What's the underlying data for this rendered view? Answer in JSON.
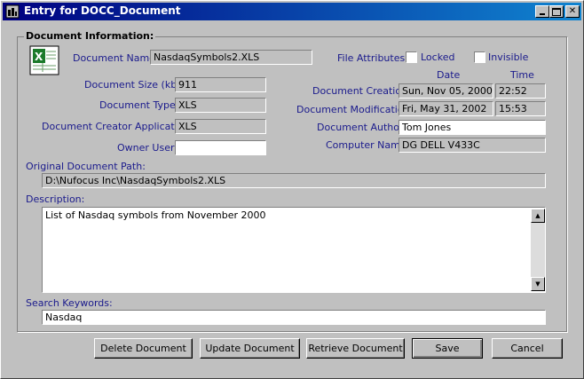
{
  "window": {
    "title": "Entry for DOCC_Document",
    "icon": "app-window-icon"
  },
  "group": {
    "title": "Document Information:"
  },
  "file_icon": "excel-file-icon",
  "fields": {
    "doc_name": {
      "label": "Document Name:",
      "value": "NasdaqSymbols2.XLS"
    },
    "doc_size": {
      "label": "Document Size (kb):",
      "value": "911"
    },
    "doc_type": {
      "label": "Document Type:",
      "value": "XLS"
    },
    "creator_app": {
      "label": "Document Creator Application:",
      "value": "XLS"
    },
    "owner_user": {
      "label": "Owner User:",
      "value": ""
    },
    "orig_path": {
      "label": "Original Document Path:",
      "value": "D:\\Nufocus Inc\\NasdaqSymbols2.XLS"
    },
    "description": {
      "label": "Description:",
      "value": "List of Nasdaq symbols from November 2000"
    },
    "keywords": {
      "label": "Search Keywords:",
      "value": "Nasdaq"
    }
  },
  "attributes": {
    "label": "File Attributes:",
    "locked": {
      "label": "Locked",
      "checked": false
    },
    "invisible": {
      "label": "Invisible",
      "checked": false
    }
  },
  "dates": {
    "date_header": "Date",
    "time_header": "Time",
    "creation": {
      "label": "Document Creation:",
      "date": "Sun, Nov 05, 2000",
      "time": "22:52"
    },
    "modification": {
      "label": "Document Modification:",
      "date": "Fri, May 31, 2002",
      "time": "15:53"
    }
  },
  "author": {
    "label": "Document  Author:",
    "value": "Tom Jones"
  },
  "computer": {
    "label": "Computer Name:",
    "value": "DG DELL V433C"
  },
  "buttons": {
    "delete": "Delete Document",
    "update": "Update Document",
    "retrieve": "Retrieve Document",
    "save": "Save",
    "cancel": "Cancel"
  },
  "colors": {
    "titlebar": "#000080",
    "label_text": "#1a1a8c",
    "face": "#c0c0c0"
  }
}
